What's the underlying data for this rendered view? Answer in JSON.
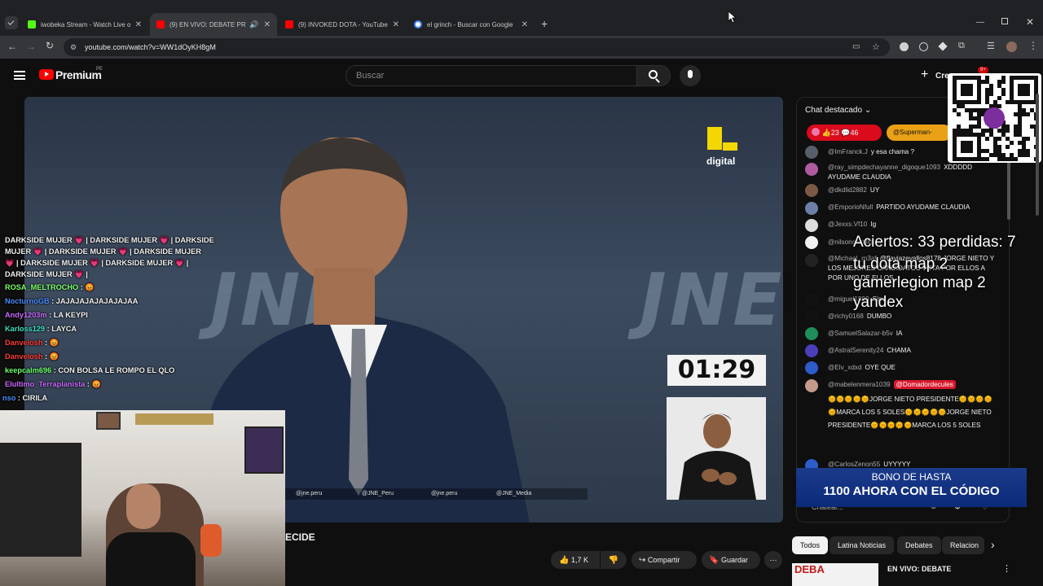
{
  "browser": {
    "tabs": [
      {
        "title": "iwobeka Stream - Watch Live o",
        "favicon_color": "#53fc18"
      },
      {
        "title": "(9) EN VIVO: DEBATE PRESI",
        "favicon_color": "#ff0000"
      },
      {
        "title": "(9) INVOKED DOTA - YouTube",
        "favicon_color": "#ff0000"
      },
      {
        "title": "el grinch - Buscar con Google",
        "favicon_color": "#4285f4"
      }
    ],
    "url": "youtube.com/watch?v=WW1dOyKH8gM",
    "new_tab": "+"
  },
  "youtube": {
    "logo": "Premium",
    "region": "PE",
    "search_placeholder": "Buscar",
    "create_label": "Cre",
    "notif_count": "9+"
  },
  "video": {
    "brand": "digital",
    "watermark": "JNE",
    "timer": "01:29",
    "social": [
      "@jne.peru",
      "@JNE_Peru",
      "@jne.peru",
      "@JNE_Media"
    ]
  },
  "overlay_chat": [
    {
      "user": "",
      "text": "DARKSIDE MUJER 💗 | DARKSIDE MUJER 💗 | DARKSIDE",
      "color": "#ffffff"
    },
    {
      "user": "",
      "text": "MUJER 💗 | DARKSIDE MUJER 💗 | DARKSIDE MUJER",
      "color": "#ffffff"
    },
    {
      "user": "",
      "text": "💗 | DARKSIDE MUJER 💗 | DARKSIDE MUJER 💗 |",
      "color": "#ffffff"
    },
    {
      "user": "",
      "text": "DARKSIDE MUJER 💗 |",
      "color": "#ffffff"
    },
    {
      "user": "ROSA_MELTROCHO",
      "text": " : 😡",
      "color": "#7dff6b"
    },
    {
      "user": "NocturnoGB",
      "text": " : JAJAJAJAJAJAJAJAA",
      "color": "#4a8cff"
    },
    {
      "user": "Andy1203m",
      "text": " : LA KEYPI",
      "color": "#c86bff"
    },
    {
      "user": "Karloss129",
      "text": " : LAYCA",
      "color": "#3de0c0"
    },
    {
      "user": "Danvelosh",
      "text": " : 😡",
      "color": "#ff3b3b"
    },
    {
      "user": "Danvelosh",
      "text": " : 😡",
      "color": "#ff3b3b"
    },
    {
      "user": "keepcalm696",
      "text": " : CON BOLSA LE ROMPO EL QLO",
      "color": "#6bff6b"
    },
    {
      "user": "Elultimo_Terraplanista",
      "text": " : 😡",
      "color": "#c86bff"
    },
    {
      "user": "nso",
      "text": " : CIRILA",
      "color": "#4a8cff"
    }
  ],
  "chat": {
    "header": "Chat destacado",
    "likes": "23",
    "comments": "46",
    "pinned_user": "@Superman-",
    "messages": [
      {
        "user": "@ImFranck.J",
        "text": "y esa chama ?"
      },
      {
        "user": "@ray_simpdechayanne_digoque1093",
        "text": "XDDDDD AYUDAME CLAUDIA"
      },
      {
        "user": "@dkdlid2882",
        "text": "UY"
      },
      {
        "user": "@EmporioNfull",
        "text": "PARTIDO AYUDAME CLAUDIA"
      },
      {
        "user": "@Jexxs.Vf10",
        "text": "Ig"
      },
      {
        "user": "@nilsoncastillo",
        "text": "..."
      },
      {
        "user": "@Michael_rn3af",
        "text": "@flaviazevallos8178 JORGE NIETO Y LOS MEJORES CANDIDATOS VOTA POR ELLOS A POR UNO DE ELLOS"
      },
      {
        "user": "@miguel1999",
        "text": "Sino"
      },
      {
        "user": "@richy0168",
        "text": "DUMBO"
      },
      {
        "user": "@SamuelSalazar-b5v",
        "text": "IA"
      },
      {
        "user": "@AstralSerenity24",
        "text": "CHAMA"
      },
      {
        "user": "@Elv_xdxd",
        "text": "OYE QUE"
      },
      {
        "user": "@mabelenmera1039",
        "text": "@Domadordecules"
      },
      {
        "user": "",
        "text": "🌞🌞🌞🌞🌞JORGE NIETO PRESIDENTE🌞🌞🌞🌞🌞MARCA LOS 5 SOLES🌞🌞🌞🌞🌞JORGE NIETO PRESIDENTE🌞🌞🌞🌞🌞MARCA LOS 5 SOLES"
      },
      {
        "user": "@CarlosZenon55",
        "text": "UYYYYY"
      }
    ],
    "input_placeholder": "Chatear..."
  },
  "stream_overlay": {
    "stats": "Aciertos: 33 perdidas: 7",
    "line2": "tu dota map 2",
    "line3": "gamerlegion map 2",
    "line4": "yandex",
    "promo_top": "BONO DE HASTA",
    "promo_main": "1100 AHORA CON EL CÓDIGO"
  },
  "below_video": {
    "title_fragment": "ECIDE",
    "likes": "1,7 K",
    "share": "Compartir",
    "save": "Guardar",
    "chips": [
      "Todos",
      "Latina Noticias",
      "Debates",
      "Relacion"
    ],
    "related_title": "EN VIVO: DEBATE",
    "related_thumb": "DEBA"
  }
}
